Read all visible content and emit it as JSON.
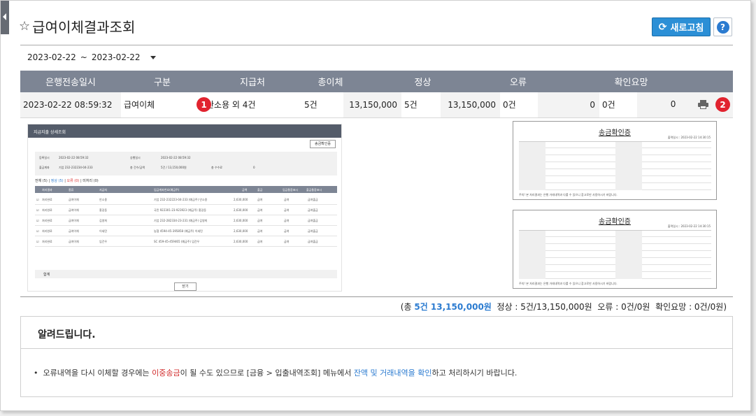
{
  "page": {
    "title": "급여이체결과조회",
    "star_icon": "star-outline-icon"
  },
  "toolbar": {
    "refresh_label": "새로고침",
    "help_label": "?"
  },
  "filter": {
    "start_date": "2023-02-22",
    "separator": "~",
    "end_date": "2023-02-22"
  },
  "table": {
    "headers": [
      "은행전송일시",
      "구분",
      "지급처",
      "총이체",
      "정상",
      "오류",
      "확인요망"
    ],
    "rows": [
      {
        "sent_datetime": "2023-02-22 08:59:32",
        "type": "급여이체",
        "payee": "안소용 외 4건",
        "total_count": "5건",
        "total_amount": "13,150,000",
        "normal_count": "5건",
        "normal_amount": "13,150,000",
        "error_count": "0건",
        "error_amount": "0",
        "check_count": "0건",
        "check_amount": "0"
      }
    ]
  },
  "markers": {
    "one": "1",
    "two": "2"
  },
  "detail_preview": {
    "title": "지급지출 상세조회",
    "confirm_button": "송금확인증",
    "info": {
      "reg_label": "등록일시",
      "reg_value": "2023-02-22 08:59:32",
      "approve_label": "승행일시",
      "approve_value": "2023-02-22 08:59:32",
      "account_label": "출금계좌",
      "account_value": "기업 232-232234-04-233",
      "total_label": "총 건수/금액",
      "total_value": "5건 / 13,150,000원",
      "fee_label": "총 수수료",
      "fee_value": "0"
    },
    "tabs": {
      "all": "전체 (5)",
      "normal": "정상 (5)",
      "error": "오류 (0)",
      "check": "미처리 (0)"
    },
    "columns": [
      "처리결과",
      "종류",
      "지급처",
      "입금계좌번호(예금주)",
      "금액",
      "출금",
      "입금통장표시",
      "출금통장표시"
    ],
    "rows": [
      {
        "status": "처리완료",
        "kind": "급여이체",
        "payee": "안소용",
        "account": "기업 232-232223-04-233 (예금주) 안소용",
        "amount": "2,630,000",
        "out": "급여",
        "in_memo": "급여",
        "out_memo": "급여출금"
      },
      {
        "status": "처리완료",
        "kind": "급여이체",
        "payee": "홍길동",
        "account": "국민 922301-23-923923 (예금주) 홍길동",
        "amount": "2,630,000",
        "out": "급여",
        "in_memo": "급여",
        "out_memo": "급여출금"
      },
      {
        "status": "처리완료",
        "kind": "급여이체",
        "payee": "김영희",
        "account": "기업 232-282334-23-231 (예금주) 김영희",
        "amount": "2,630,000",
        "out": "급여",
        "in_memo": "급여",
        "out_memo": "급여출금"
      },
      {
        "status": "처리완료",
        "kind": "급여이체",
        "payee": "이세민",
        "account": "농협 4594-45-395858 (예금주) 이세민",
        "amount": "2,630,000",
        "out": "급여",
        "in_memo": "급여",
        "out_memo": "급여출금"
      },
      {
        "status": "처리완료",
        "kind": "급여이체",
        "payee": "임건우",
        "account": "SC 459-45-459465 (예금주) 임건우",
        "amount": "2,630,000",
        "out": "급여",
        "in_memo": "급여",
        "out_memo": "급여출금"
      }
    ],
    "footer_label": "합계",
    "close_button": "닫기"
  },
  "certificates": [
    {
      "title": "송금확인증",
      "date": "출력일시 : 2023-02-22 14:30:15",
      "note": "주의! 본 처리결과는 은행 거래내역과 다를 수 있으니 참고로만 사용하시기 바랍니다."
    },
    {
      "title": "송금확인증",
      "date": "출력일시 : 2023-02-22 14:30:15",
      "note": "주의! 본 처리결과는 은행 거래내역과 다를 수 있으니 참고로만 사용하시기 바랍니다."
    }
  ],
  "summary": {
    "open": "(총 ",
    "total": "5건 13,150,000원",
    "rest": "  정상 : 5건/13,150,000원  오류 : 0건/0원  확인요망 : 0건/0원)"
  },
  "notice": {
    "title": "알려드립니다.",
    "part1": "•  오류내역을 다시 이체할 경우에는 ",
    "red": "이중송금",
    "part2": "이 될 수도 있으므로 [금융 > 입출내역조회] 메뉴에서 ",
    "blue": "잔액 및 거래내역을 확인",
    "part3": "하고 처리하시기 바랍니다."
  },
  "colors": {
    "header_bg": "#7d8594",
    "accent_blue": "#2b8fd6",
    "marker_red": "#e1232f"
  }
}
